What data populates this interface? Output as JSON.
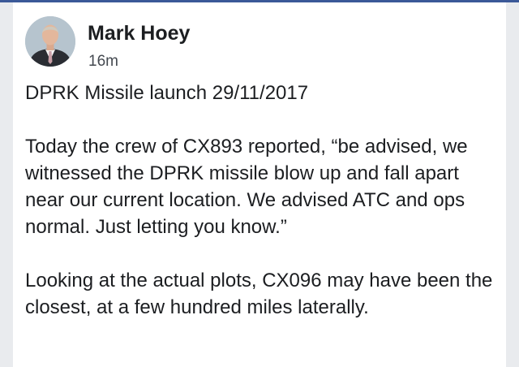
{
  "post": {
    "author": "Mark Hoey",
    "timestamp": "16m",
    "avatar_icon": "profile-photo-avatar",
    "paragraphs": [
      "DPRK Missile launch 29/11/2017",
      "Today the crew of CX893 reported, “be advised, we witnessed the DPRK missile blow up and fall apart near our current location. We advised ATC and ops normal. Just letting you know.”",
      "Looking at the actual plots, CX096 may have been the closest, at a few hundred miles laterally."
    ]
  },
  "colors": {
    "accent": "#3b5998",
    "text": "#1c1e21",
    "meta": "#444950",
    "background": "#e9ebee"
  }
}
